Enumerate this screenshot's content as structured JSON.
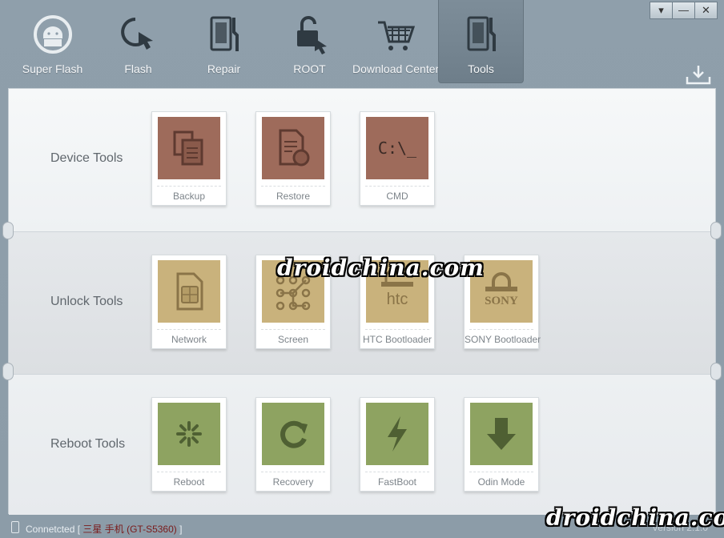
{
  "window": {
    "controls": {
      "dropdown": "▾",
      "minimize": "—",
      "close": "✕"
    }
  },
  "toolbar": [
    {
      "label": "Super Flash",
      "icon": "android-sync-icon"
    },
    {
      "label": "Flash",
      "icon": "flash-touch-icon"
    },
    {
      "label": "Repair",
      "icon": "repair-tablet-icon"
    },
    {
      "label": "ROOT",
      "icon": "unlock-icon"
    },
    {
      "label": "Download Center",
      "icon": "cart-icon"
    },
    {
      "label": "Tools",
      "icon": "tools-icon",
      "active": true
    }
  ],
  "sections": [
    {
      "title": "Device Tools",
      "tiles": [
        {
          "label": "Backup",
          "icon": "backup-icon",
          "color": "#9e6b5b"
        },
        {
          "label": "Restore",
          "icon": "restore-icon",
          "color": "#9e6b5b"
        },
        {
          "label": "CMD",
          "icon": "cmd-icon",
          "glyph": "C:\\_",
          "color": "#9e6b5b"
        }
      ]
    },
    {
      "title": "Unlock Tools",
      "tiles": [
        {
          "label": "Network",
          "icon": "sim-card-icon",
          "color": "#c9b27c"
        },
        {
          "label": "Screen",
          "icon": "pattern-lock-icon",
          "color": "#c9b27c"
        },
        {
          "label": "HTC Bootloader",
          "icon": "htc-lock-icon",
          "glyph": "htc",
          "color": "#c9b27c"
        },
        {
          "label": "SONY Bootloader",
          "icon": "sony-lock-icon",
          "glyph": "SONY",
          "color": "#c9b27c"
        }
      ]
    },
    {
      "title": "Reboot Tools",
      "tiles": [
        {
          "label": "Reboot",
          "icon": "reboot-icon",
          "color": "#8ea361"
        },
        {
          "label": "Recovery",
          "icon": "recovery-icon",
          "color": "#8ea361"
        },
        {
          "label": "FastBoot",
          "icon": "fastboot-icon",
          "color": "#8ea361"
        },
        {
          "label": "Odin Mode",
          "icon": "odin-download-icon",
          "color": "#8ea361"
        }
      ]
    }
  ],
  "status": {
    "connected": "Connetcted",
    "bracket_open": "[",
    "device": "三星 手机 (GT-S5360)",
    "bracket_close": "]",
    "version": "Version 2.1.0"
  },
  "watermark": "droidchina.com"
}
